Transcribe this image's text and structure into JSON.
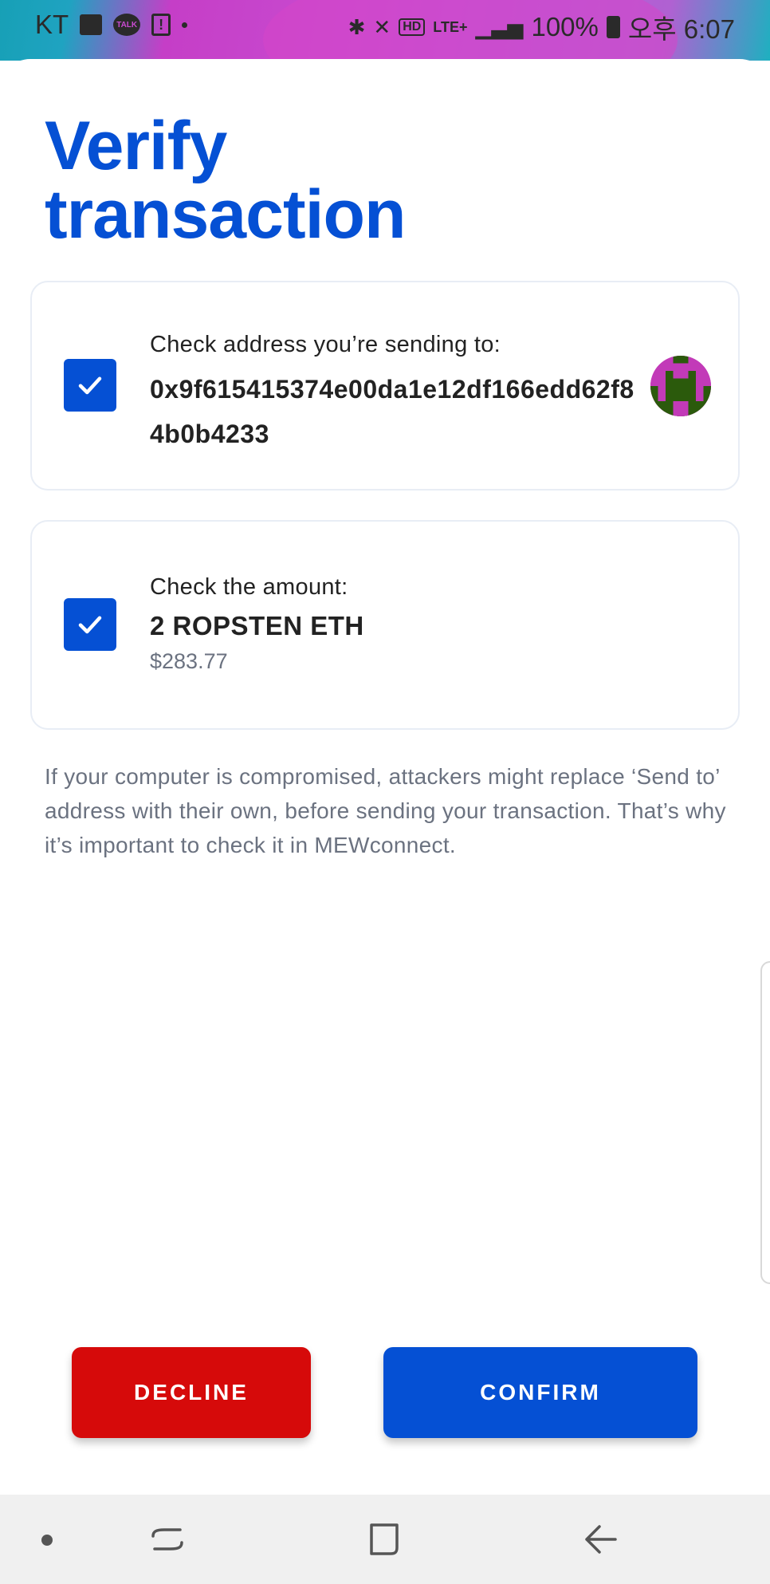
{
  "status_bar": {
    "carrier": "KT",
    "talk_label": "TALK",
    "exclaim": "!",
    "hd": "HD",
    "lte": "LTE+",
    "battery": "100%",
    "time": "오후 6:07"
  },
  "title": "Verify transaction",
  "address_card": {
    "label": "Check address you’re sending to:",
    "address": "0x9f615415374e00da1e12df166edd62f84b0b4233",
    "checked": true
  },
  "amount_card": {
    "label": "Check the amount:",
    "amount": "2 ROPSTEN ETH",
    "fiat": "$283.77",
    "checked": true
  },
  "warning": "If your computer is compromised, attackers might replace ‘Send to’ address with their own, before sending your transaction. That’s why it’s important to check it in MEWconnect.",
  "buttons": {
    "decline": "DECLINE",
    "confirm": "CONFIRM"
  },
  "colors": {
    "accent": "#0550d4",
    "decline": "#d60a0a",
    "identicon_primary": "#c23ab8",
    "identicon_secondary": "#2b5a0c"
  },
  "icons": {
    "checkbox": "check-icon",
    "nav": [
      "recent-apps-icon",
      "home-icon",
      "back-icon"
    ]
  }
}
